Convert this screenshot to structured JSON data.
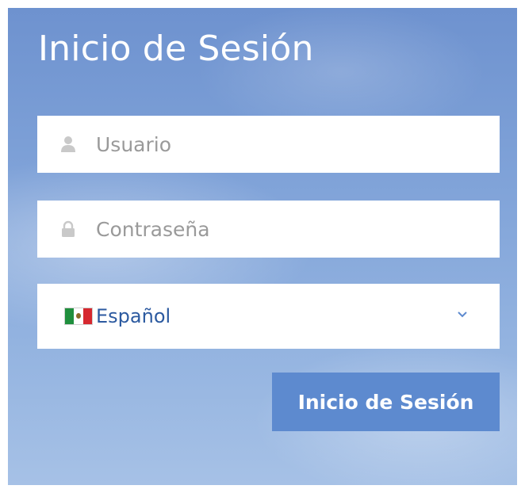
{
  "login": {
    "title": "Inicio de Sesión",
    "username": {
      "placeholder": "Usuario",
      "value": "",
      "icon": "user-icon"
    },
    "password": {
      "placeholder": "Contraseña",
      "value": "",
      "icon": "lock-icon"
    },
    "language": {
      "selected": "Español",
      "icon": "mexico-flag-icon"
    },
    "submit_label": "Inicio de Sesión"
  },
  "colors": {
    "panel_blue": "#7fa2d8",
    "button_blue": "#5d8acf",
    "language_text": "#2c5aa0",
    "placeholder_text": "#9a9a9a"
  }
}
